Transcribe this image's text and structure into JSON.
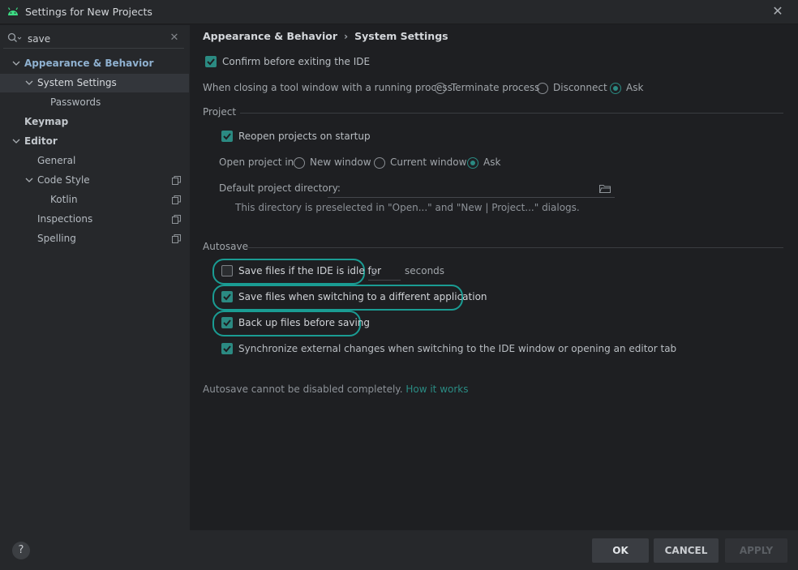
{
  "window": {
    "title": "Settings for New Projects",
    "close_glyph": "✕",
    "logo_icon": "android-icon"
  },
  "search": {
    "value": "save",
    "clear_glyph": "✕"
  },
  "tree": [
    {
      "label": "Appearance & Behavior",
      "expanded": true,
      "style": "accent"
    },
    {
      "label": "System Settings",
      "expanded": true,
      "selected": true
    },
    {
      "label": "Passwords"
    },
    {
      "label": "Keymap",
      "style": "bold"
    },
    {
      "label": "Editor",
      "expanded": true,
      "style": "bold"
    },
    {
      "label": "General"
    },
    {
      "label": "Code Style",
      "expanded": true,
      "has_copy_icon": true
    },
    {
      "label": "Kotlin",
      "has_copy_icon": true
    },
    {
      "label": "Inspections",
      "has_copy_icon": true
    },
    {
      "label": "Spelling",
      "has_copy_icon": true
    }
  ],
  "breadcrumb": {
    "parent": "Appearance & Behavior",
    "separator": "›",
    "current": "System Settings"
  },
  "settings": {
    "confirm_exit": {
      "label": "Confirm before exiting the IDE",
      "checked": true
    },
    "closing_tool_window": {
      "label": "When closing a tool window with a running process:",
      "options": [
        "Terminate process",
        "Disconnect",
        "Ask"
      ],
      "selected": "Ask"
    },
    "project_section": "Project",
    "reopen_projects": {
      "label": "Reopen projects on startup",
      "checked": true
    },
    "open_project_in": {
      "label": "Open project in",
      "options": [
        "New window",
        "Current window",
        "Ask"
      ],
      "selected": "Ask"
    },
    "default_dir": {
      "label": "Default project directory:",
      "value": "",
      "hint": "This directory is preselected in \"Open...\" and \"New | Project...\" dialogs."
    },
    "autosave_section": "Autosave",
    "save_idle": {
      "label": "Save files if the IDE is idle for",
      "checked": false,
      "value": "5",
      "unit": "seconds"
    },
    "save_switch": {
      "label": "Save files when switching to a different application",
      "checked": true
    },
    "backup": {
      "label": "Back up files before saving",
      "checked": true
    },
    "sync_external": {
      "label": "Synchronize external changes when switching to the IDE window or opening an editor tab",
      "checked": true
    },
    "autosave_note": "Autosave cannot be disabled completely.",
    "how_it_works": "How it works"
  },
  "footer": {
    "help": "?",
    "ok": "OK",
    "cancel": "CANCEL",
    "apply": "APPLY"
  },
  "colors": {
    "accent": "#2b8a82",
    "highlight_outline": "#1a9c93",
    "background": "#1e1f22",
    "panel": "#26282b"
  }
}
